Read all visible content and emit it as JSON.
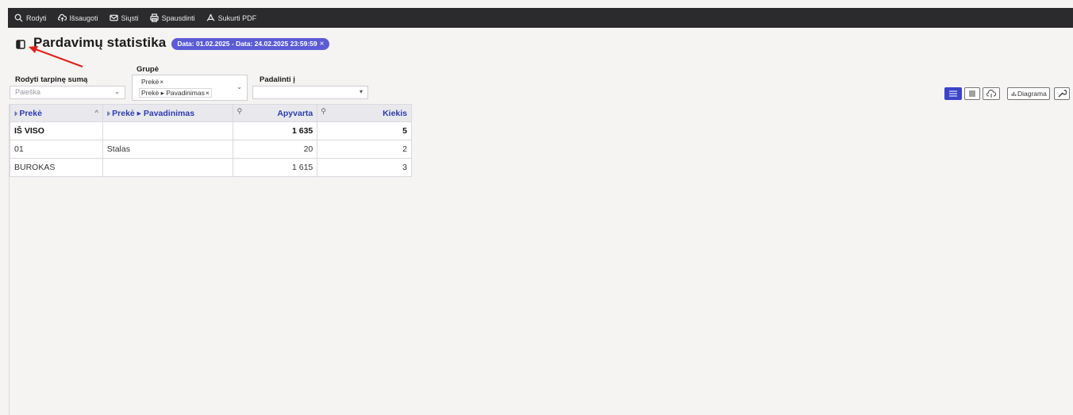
{
  "toolbar": {
    "items": [
      {
        "label": "Rodyti",
        "icon": "search-icon"
      },
      {
        "label": "Išsaugoti",
        "icon": "cloud-upload-icon"
      },
      {
        "label": "Siųsti",
        "icon": "mail-icon"
      },
      {
        "label": "Spausdinti",
        "icon": "printer-icon"
      },
      {
        "label": "Sukurti PDF",
        "icon": "pdf-icon"
      }
    ]
  },
  "header": {
    "title": "Pardavimų statistika",
    "date_filter": "Data: 01.02.2025 - Data: 24.02.2025 23:59:59",
    "chip_close": "×"
  },
  "filters": {
    "rodyti_label": "Rodyti tarpinę sumą",
    "rodyti_placeholder": "Paieška",
    "grupe_label": "Grupė",
    "grupe_tags": [
      "Prekė",
      "Prekė ▸ Pavadinimas"
    ],
    "tag_close": "×",
    "padalinti_label": "Padalinti į",
    "chevron": "⌄",
    "select_arrow": "▾"
  },
  "right_buttons": {
    "diagram_label": "Diagrama"
  },
  "table": {
    "pin": "⊧",
    "wrench": "⚲",
    "sort": "^",
    "headers": [
      "Prekė",
      "Prekė ▸ Pavadinimas",
      "Apyvarta",
      "Kiekis"
    ],
    "total": {
      "label": "IŠ VISO",
      "name": "",
      "apyvarta": "1 635",
      "kiekis": "5"
    },
    "rows": [
      {
        "code": "01",
        "name": "Stalas",
        "apyvarta": "20",
        "kiekis": "2"
      },
      {
        "code": "BUROKAS",
        "name": "",
        "apyvarta": "1 615",
        "kiekis": "3"
      }
    ]
  },
  "colors": {
    "toolbar_bg": "#2b2b2e",
    "chip_bg": "#5b5bd6",
    "link": "#2d3bb5",
    "arrow": "#e0201a"
  }
}
